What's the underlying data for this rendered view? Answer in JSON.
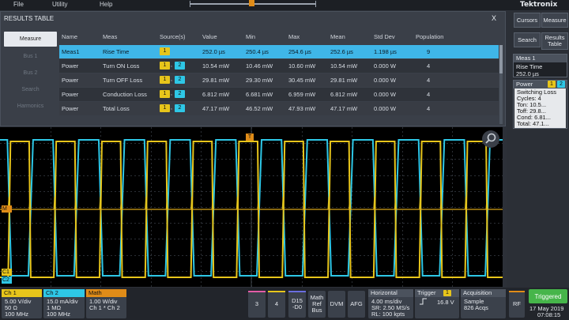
{
  "menu": {
    "items": [
      "File",
      "Utility",
      "Help"
    ],
    "brand": "Tektronix"
  },
  "results_table": {
    "title": "RESULTS TABLE",
    "close": "X",
    "side_tabs": [
      "Measure",
      "Bus 1",
      "Bus 2",
      "Search",
      "Harmonics"
    ],
    "headers": [
      "Name",
      "Meas",
      "Source(s)",
      "Value",
      "Min",
      "Max",
      "Mean",
      "Std Dev",
      "Population"
    ],
    "rows": [
      {
        "name": "Meas1",
        "meas": "Rise Time",
        "sources": [
          "1"
        ],
        "value": "252.0 µs",
        "min": "250.4 µs",
        "max": "254.6 µs",
        "mean": "252.6 µs",
        "std": "1.198 µs",
        "pop": "9"
      },
      {
        "name": "Power",
        "meas": "Turn ON Loss",
        "sources": [
          "1",
          "2"
        ],
        "value": "10.54 mW",
        "min": "10.46 mW",
        "max": "10.60 mW",
        "mean": "10.54 mW",
        "std": "0.000 W",
        "pop": "4"
      },
      {
        "name": "Power",
        "meas": "Turn OFF Loss",
        "sources": [
          "1",
          "2"
        ],
        "value": "29.81 mW",
        "min": "29.30 mW",
        "max": "30.45 mW",
        "mean": "29.81 mW",
        "std": "0.000 W",
        "pop": "4"
      },
      {
        "name": "Power",
        "meas": "Conduction Loss",
        "sources": [
          "1",
          "2"
        ],
        "value": "6.812 mW",
        "min": "6.681 mW",
        "max": "6.959 mW",
        "mean": "6.812 mW",
        "std": "0.000 W",
        "pop": "4"
      },
      {
        "name": "Power",
        "meas": "Total Loss",
        "sources": [
          "1",
          "2"
        ],
        "value": "47.17 mW",
        "min": "46.52 mW",
        "max": "47.93 mW",
        "mean": "47.17 mW",
        "std": "0.000 W",
        "pop": "4"
      }
    ]
  },
  "right_panel": {
    "buttons": [
      "Cursors",
      "Measure",
      "Search",
      "Results Table"
    ],
    "meas1": {
      "title": "Meas 1",
      "line1": "Rise Time",
      "line2": "252.0 µs"
    },
    "power": {
      "title": "Power",
      "src": [
        "1",
        "2"
      ],
      "lines": [
        "Switching Loss",
        "Cycles:   4",
        "Ton:     10.5...",
        "Toff:    29.8...",
        "Cond:    6.81...",
        "Total:   47.1..."
      ]
    }
  },
  "scope": {
    "markers": [
      "M",
      "C1",
      "C2"
    ],
    "trigger_marker": "T"
  },
  "bottom": {
    "ch1": {
      "title": "Ch 1",
      "lines": [
        "5.00 V/div",
        "50 Ω",
        "100 MHz"
      ]
    },
    "ch2": {
      "title": "Ch 2",
      "lines": [
        "15.0 mA/div",
        "1 MΩ",
        "100 MHz"
      ]
    },
    "math": {
      "title": "Math",
      "lines": [
        "1.00 W/div",
        "Ch 1 * Ch 2"
      ]
    },
    "buttons": [
      "3",
      "4",
      "D15\n-D0",
      "Math\nRef\nBus",
      "DVM",
      "AFG"
    ],
    "horizontal": {
      "title": "Horizontal",
      "lines": [
        "4.00 ms/div",
        "SR: 2.50 MS/s",
        "RL: 100 kpts"
      ]
    },
    "trigger": {
      "title": "Trigger",
      "src": "1",
      "level": "16.8 V"
    },
    "acquisition": {
      "title": "Acquisition",
      "lines": [
        "Sample",
        "826 Acqs"
      ]
    },
    "rf": "RF",
    "status": "Triggered",
    "date": "17 May 2019",
    "time": "07:08:15"
  },
  "colors": {
    "ch1": "#e7c51b",
    "ch2": "#2ec7e6",
    "math": "#e08c18",
    "accent": "#3fb6e8"
  }
}
